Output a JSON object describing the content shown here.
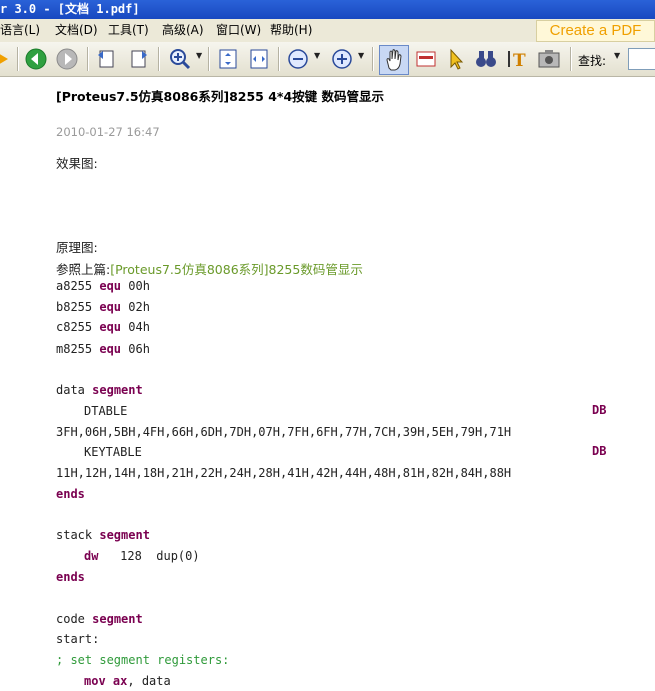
{
  "window": {
    "title": "r 3.0 - [文档 1.pdf]"
  },
  "menu": {
    "items": [
      "语言(L)",
      "文档(D)",
      "工具(T)",
      "高级(A)",
      "窗口(W)",
      "帮助(H)"
    ],
    "brand": "Create a PDF"
  },
  "toolbar": {
    "find_label": "查找:",
    "icons": [
      "arrow-right-icon",
      "back-icon",
      "forward-icon",
      "rotate-left-icon",
      "rotate-right-icon",
      "zoom-in-icon",
      "fit-page-icon",
      "fit-width-icon",
      "zoom-out-icon",
      "zoom-plus-icon",
      "hand-tool-icon",
      "scan-icon",
      "select-arrow-icon",
      "binoculars-icon",
      "text-select-icon",
      "snapshot-icon"
    ]
  },
  "post": {
    "title": "[Proteus7.5仿真8086系列]8255 4*4按键 数码管显示",
    "date": "2010-01-27 16:47",
    "effect_label": "效果图:",
    "schematic_label": "原理图:",
    "ref_prefix": "参照上篇:",
    "ref_link": "[Proteus7.5仿真8086系列]8255数码管显示"
  },
  "code": {
    "equ": [
      {
        "name": "a8255",
        "kw": "equ",
        "val": "00h"
      },
      {
        "name": "b8255",
        "kw": "equ",
        "val": "02h"
      },
      {
        "name": "c8255",
        "kw": "equ",
        "val": "04h"
      },
      {
        "name": "m8255",
        "kw": "equ",
        "val": "06h"
      }
    ],
    "data_seg": {
      "name": "data",
      "kw": "segment"
    },
    "dtable": "DTABLE",
    "db": "DB",
    "dtable_vals": "3FH,06H,5BH,4FH,66H,6DH,7DH,07H,7FH,6FH,77H,7CH,39H,5EH,79H,71H",
    "keytable": "KEYTABLE",
    "keytable_vals": "11H,12H,14H,18H,21H,22H,24H,28H,41H,42H,44H,48H,81H,82H,84H,88H",
    "ends": "ends",
    "stack_seg": {
      "name": "stack",
      "kw": "segment"
    },
    "dw_kw": "dw",
    "dw_rest": "   128  dup(0)",
    "code_seg": {
      "name": "code",
      "kw": "segment"
    },
    "start": "start:",
    "comment": "; set segment registers:",
    "mov_kw": "mov",
    "reg_kw": "ax",
    "mov_rest": ", data"
  }
}
